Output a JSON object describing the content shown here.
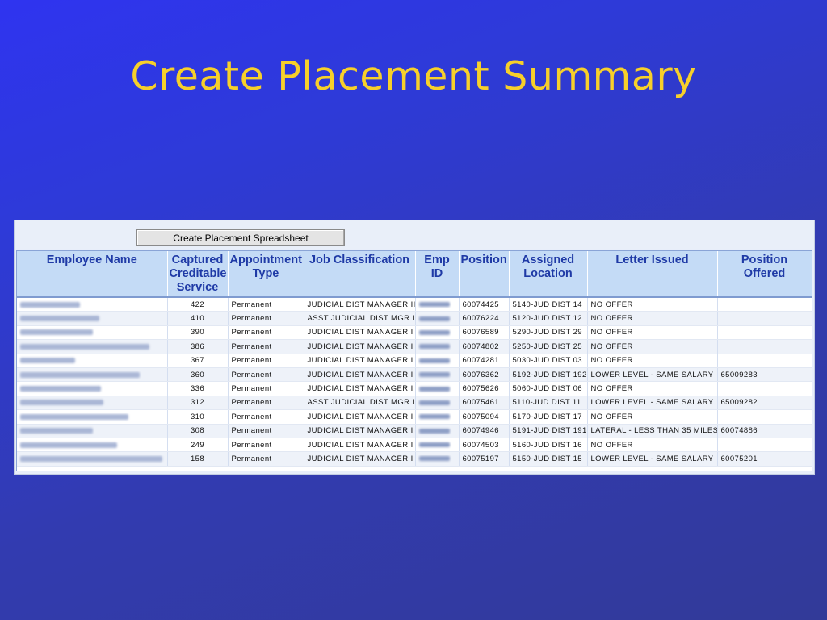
{
  "title": "Create Placement Summary",
  "toolbar": {
    "button_label": "Create Placement Spreadsheet"
  },
  "columns": [
    "Employee Name",
    "Captured Creditable Service",
    "Appointment Type",
    "Job Classification",
    "Emp ID",
    "Position",
    "Assigned Location",
    "Letter Issued",
    "Position Offered"
  ],
  "rows": [
    {
      "service": "422",
      "type": "Permanent",
      "job": "JUDICIAL DIST MANAGER III",
      "position": "60074425",
      "location": "5140-JUD DIST 14",
      "letter": "NO OFFER",
      "offered": ""
    },
    {
      "service": "410",
      "type": "Permanent",
      "job": "ASST JUDICIAL DIST MGR I",
      "position": "60076224",
      "location": "5120-JUD DIST 12",
      "letter": "NO OFFER",
      "offered": ""
    },
    {
      "service": "390",
      "type": "Permanent",
      "job": "JUDICIAL DIST MANAGER I",
      "position": "60076589",
      "location": "5290-JUD DIST 29",
      "letter": "NO OFFER",
      "offered": ""
    },
    {
      "service": "386",
      "type": "Permanent",
      "job": "JUDICIAL DIST MANAGER I",
      "position": "60074802",
      "location": "5250-JUD DIST 25",
      "letter": "NO OFFER",
      "offered": ""
    },
    {
      "service": "367",
      "type": "Permanent",
      "job": "JUDICIAL DIST MANAGER I",
      "position": "60074281",
      "location": "5030-JUD DIST 03",
      "letter": "NO OFFER",
      "offered": ""
    },
    {
      "service": "360",
      "type": "Permanent",
      "job": "JUDICIAL DIST MANAGER I",
      "position": "60076362",
      "location": "5192-JUD DIST 192",
      "letter": "LOWER LEVEL - SAME SALARY",
      "offered": "65009283"
    },
    {
      "service": "336",
      "type": "Permanent",
      "job": "JUDICIAL DIST MANAGER I",
      "position": "60075626",
      "location": "5060-JUD DIST 06",
      "letter": "NO OFFER",
      "offered": ""
    },
    {
      "service": "312",
      "type": "Permanent",
      "job": "ASST JUDICIAL DIST MGR I",
      "position": "60075461",
      "location": "5110-JUD DIST 11",
      "letter": "LOWER LEVEL - SAME SALARY",
      "offered": "65009282"
    },
    {
      "service": "310",
      "type": "Permanent",
      "job": "JUDICIAL DIST MANAGER I",
      "position": "60075094",
      "location": "5170-JUD DIST 17",
      "letter": "NO OFFER",
      "offered": ""
    },
    {
      "service": "308",
      "type": "Permanent",
      "job": "JUDICIAL DIST MANAGER I",
      "position": "60074946",
      "location": "5191-JUD DIST 191",
      "letter": "LATERAL - LESS THAN 35 MILES",
      "offered": "60074886"
    },
    {
      "service": "249",
      "type": "Permanent",
      "job": "JUDICIAL DIST MANAGER I",
      "position": "60074503",
      "location": "5160-JUD DIST 16",
      "letter": "NO OFFER",
      "offered": ""
    },
    {
      "service": "158",
      "type": "Permanent",
      "job": "JUDICIAL DIST MANAGER I",
      "position": "60075197",
      "location": "5150-JUD DIST 15",
      "letter": "LOWER LEVEL - SAME SALARY",
      "offered": "60075201"
    }
  ]
}
